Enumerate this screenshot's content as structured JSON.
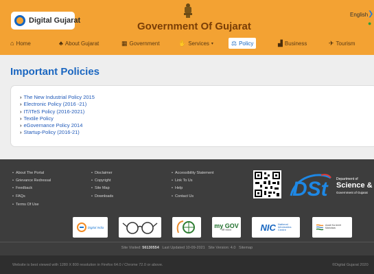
{
  "header": {
    "logo_text": "Digital Gujarat",
    "title": "Government Of Gujarat",
    "language": "English",
    "nav": [
      {
        "label": "Home",
        "icon": "home-icon"
      },
      {
        "label": "About Gujarat",
        "icon": "bell-icon"
      },
      {
        "label": "Government",
        "icon": "building-icon"
      },
      {
        "label": "Services",
        "icon": "hand-icon"
      },
      {
        "label": "Policy",
        "icon": "scale-icon"
      },
      {
        "label": "Business",
        "icon": "industry-icon"
      },
      {
        "label": "Tourism",
        "icon": "travel-icon"
      }
    ]
  },
  "main": {
    "title": "Important Policies",
    "policies": [
      "The New Industrial Policy 2015",
      "Electronic Policy (2016 -21)",
      "IT/ITeS Policy (2016-2021)",
      "Textile Policy",
      "eGovernance Policy 2014",
      "Startup-Policy (2016-21)"
    ]
  },
  "footer": {
    "col1": [
      "About The Portal",
      "Grievance Redressal",
      "Feedback",
      "FAQs",
      "Terms Of Use"
    ],
    "col2": [
      "Disclaimer",
      "Copyright",
      "Site Map",
      "Downloads"
    ],
    "col3": [
      "Accessibility Statement",
      "Link To Us",
      "Help",
      "Contact Us"
    ],
    "dst": {
      "dept_line": "Department of",
      "name": "Science & T",
      "gov": "Government of Gujarat"
    },
    "partners": {
      "digital_india": "Digital India",
      "mygov": "my GOV",
      "mygov_hindi": "मेरी सरकार",
      "nic_name": "NIC",
      "nic_sub1": "National",
      "nic_sub2": "Informatics",
      "nic_sub3": "Centre",
      "azadi": "Azadi Ka Amrit Mahotsav"
    },
    "stats": {
      "visited_label": "Site Visited:",
      "visited_value": "56130554",
      "updated": "Last Updated 10-09-2021",
      "version": "Site Version: 4.0",
      "sitemap": "Sitemap"
    },
    "best_viewed": "Website is best viewed with 1280 X 800 resolution in Firefox 64.0 / Chrome 72.0 or above.",
    "copyright": "©Digital Gujarat 2020"
  },
  "colors": {
    "header_bg": "#f3a233",
    "accent": "#1a66c0",
    "footer_bg": "#3d3d3d"
  }
}
